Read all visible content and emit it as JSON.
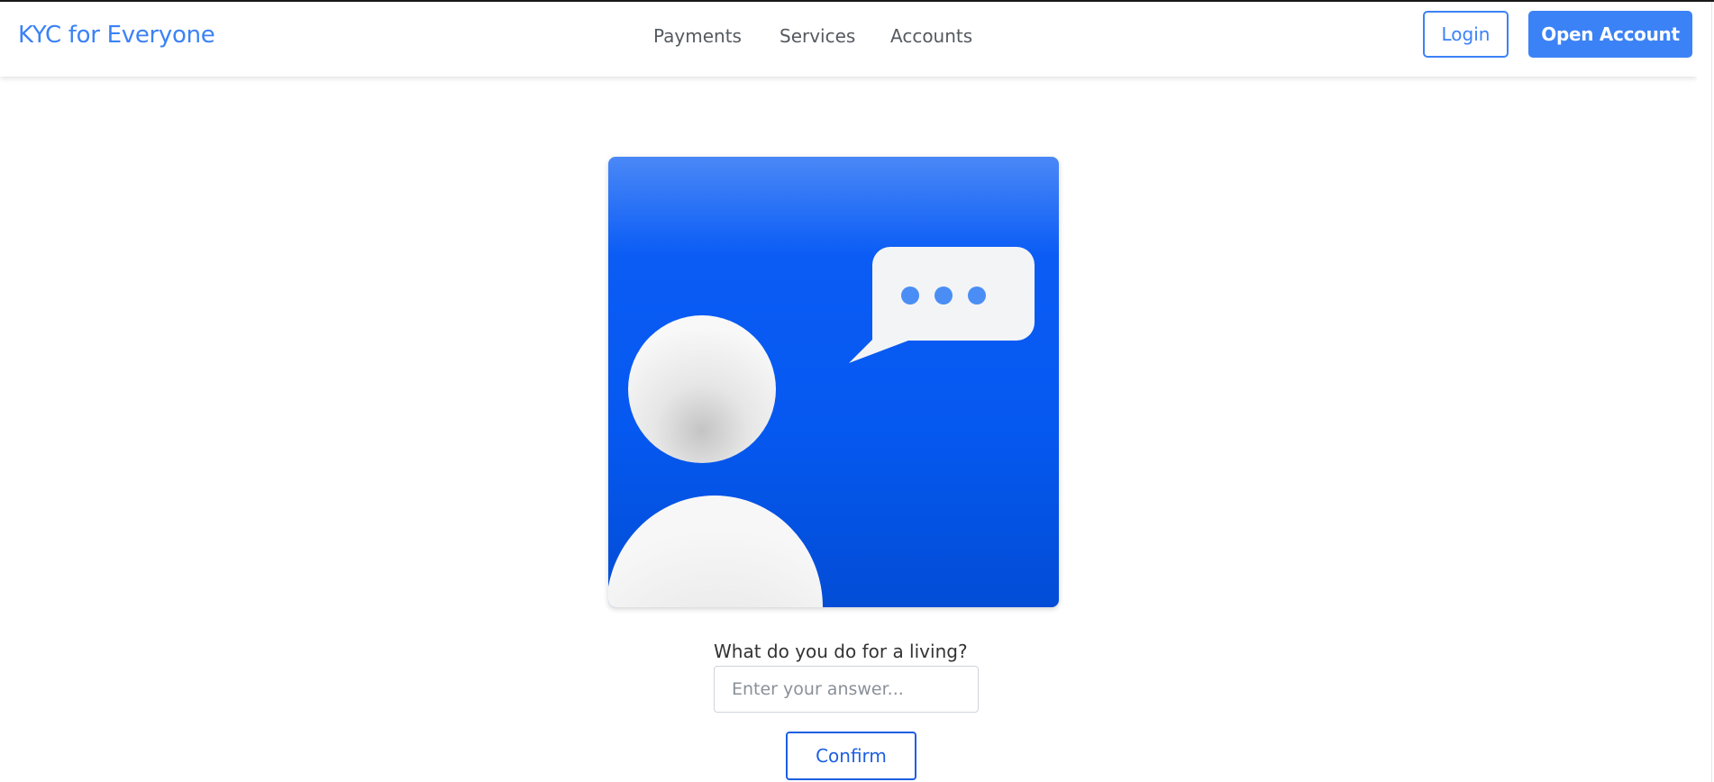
{
  "header": {
    "brand": "KYC for Everyone",
    "nav": [
      "Payments",
      "Services",
      "Accounts"
    ],
    "login_label": "Login",
    "open_account_label": "Open Account"
  },
  "hero": {
    "illustration": "user-chat-illustration"
  },
  "form": {
    "question": "What do you do for a living?",
    "answer_value": "",
    "answer_placeholder": "Enter your answer...",
    "confirm_label": "Confirm"
  },
  "colors": {
    "brand": "#3b82f6",
    "hero_blue": "#0558f0",
    "confirm_blue": "#1d5fe0"
  }
}
